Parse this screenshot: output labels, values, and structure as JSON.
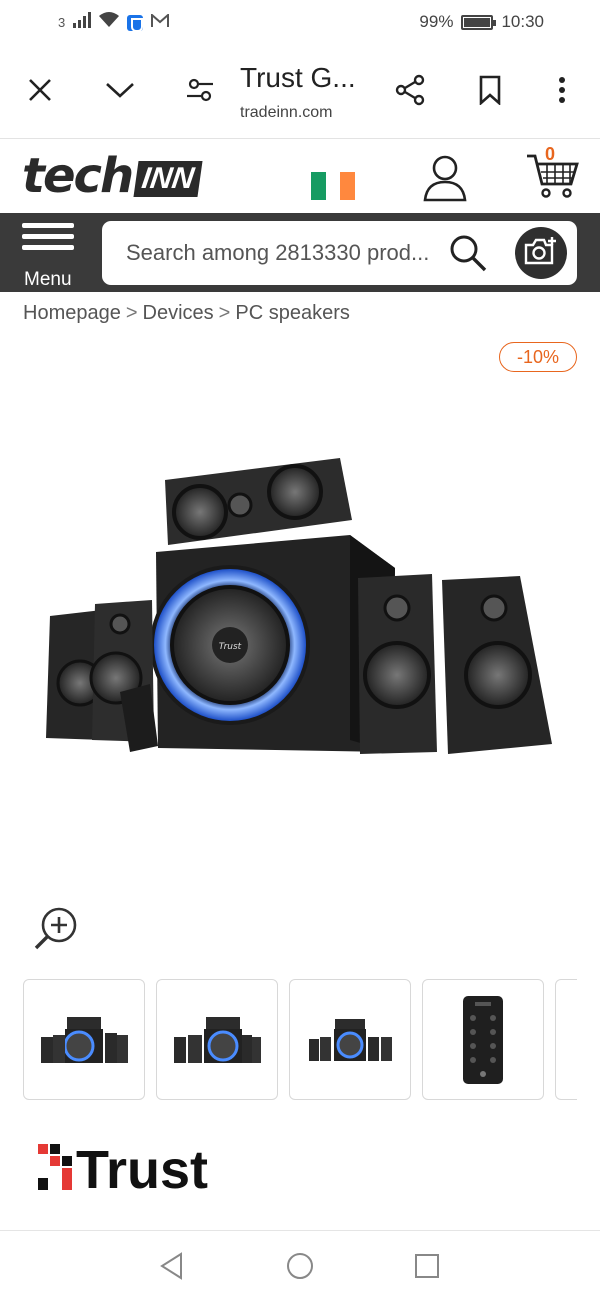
{
  "status_bar": {
    "sim_indicator": "3",
    "battery_percent": "99%",
    "battery_level": 0.99,
    "time": "10:30",
    "icons": [
      "signal-icon",
      "wifi-icon",
      "vpn-shield-icon",
      "gmail-icon"
    ]
  },
  "browser": {
    "tab_title": "Trust G...",
    "url": "tradeinn.com",
    "icons": [
      "close-icon",
      "chevron-down-icon",
      "tune-icon",
      "share-icon",
      "bookmark-icon",
      "more-vert-icon"
    ]
  },
  "site": {
    "logo_text_tech": "tech",
    "logo_text_inn": "INN",
    "flag_colors": [
      "#169b62",
      "#ffffff",
      "#ff883e"
    ],
    "cart_count": "0",
    "accent": "#e8661e",
    "dark": "#3a3a3a"
  },
  "search": {
    "menu_label": "Menu",
    "placeholder": "Search among 2813330 prod..."
  },
  "breadcrumb": [
    "Homepage",
    "Devices",
    "PC speakers"
  ],
  "product": {
    "discount_badge": "-10%",
    "brand": "Trust",
    "thumbnail_count": 4
  }
}
